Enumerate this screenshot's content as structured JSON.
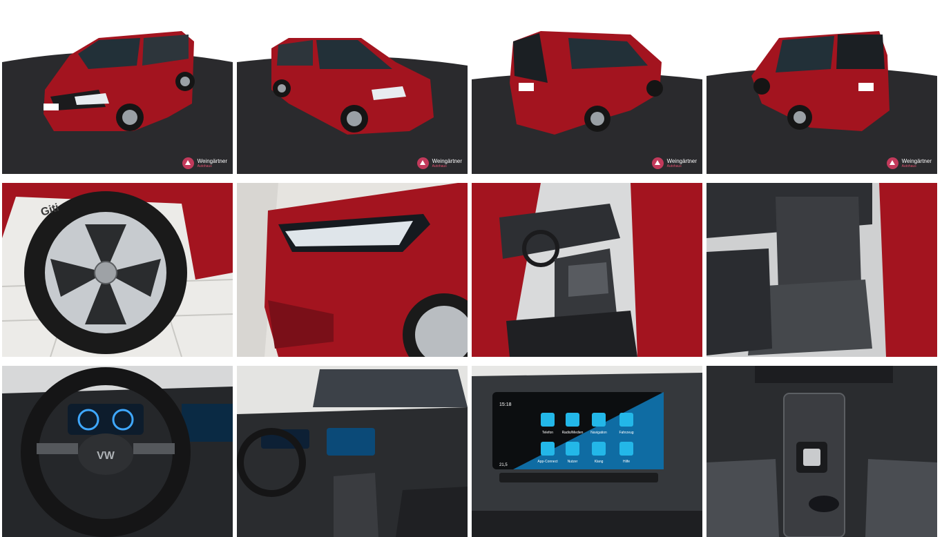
{
  "watermark": {
    "name": "Weingärtner",
    "sub": "Autohaus"
  },
  "gallery": {
    "photos": [
      {
        "subject": "exterior front three-quarter left"
      },
      {
        "subject": "exterior front three-quarter right"
      },
      {
        "subject": "exterior rear three-quarter left"
      },
      {
        "subject": "exterior rear three-quarter right"
      },
      {
        "subject": "alloy wheel"
      },
      {
        "subject": "headlight close-up"
      },
      {
        "subject": "driver door open interior"
      },
      {
        "subject": "front passenger seat"
      },
      {
        "subject": "steering wheel and digital cockpit"
      },
      {
        "subject": "dashboard overview"
      },
      {
        "subject": "infotainment screen"
      },
      {
        "subject": "center console"
      }
    ],
    "tyre_brand": "Giti",
    "steering_badge": "VW",
    "infotainment": {
      "clock": "15:18",
      "temperature": "21,5",
      "apps": [
        "Telefon",
        "Radio/Medien",
        "Navigation",
        "Fahrzeug",
        "App-Connect",
        "Nutzer",
        "Klang",
        "Hilfe"
      ]
    }
  },
  "colors": {
    "body": "#a3141f",
    "floor": "#2a2a2d",
    "accent": "#c23a5b"
  }
}
